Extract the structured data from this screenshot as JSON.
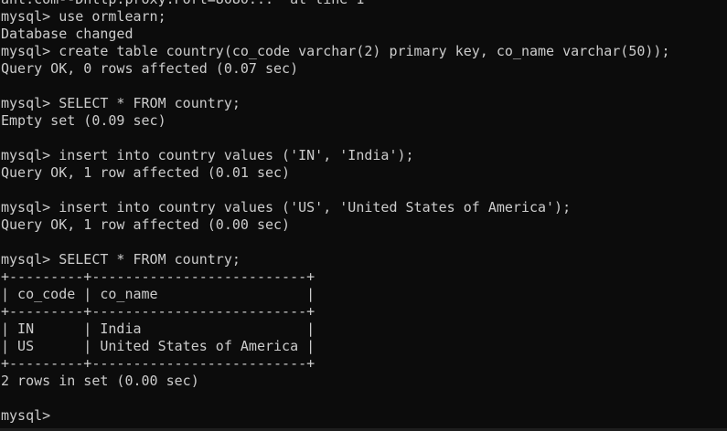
{
  "terminal": {
    "lines": [
      "ant.com--Dhttp.proxy.Port=8080...' at line 1",
      "mysql> use ormlearn;",
      "Database changed",
      "mysql> create table country(co_code varchar(2) primary key, co_name varchar(50));",
      "Query OK, 0 rows affected (0.07 sec)",
      "",
      "mysql> SELECT * FROM country;",
      "Empty set (0.09 sec)",
      "",
      "mysql> insert into country values ('IN', 'India');",
      "Query OK, 1 row affected (0.01 sec)",
      "",
      "mysql> insert into country values ('US', 'United States of America');",
      "Query OK, 1 row affected (0.00 sec)",
      "",
      "mysql> SELECT * FROM country;",
      "+---------+--------------------------+",
      "| co_code | co_name                  |",
      "+---------+--------------------------+",
      "| IN      | India                    |",
      "| US      | United States of America |",
      "+---------+--------------------------+",
      "2 rows in set (0.00 sec)",
      "",
      "mysql>"
    ]
  },
  "colors": {
    "background": "#0c0c0c",
    "text": "#cccccc"
  }
}
